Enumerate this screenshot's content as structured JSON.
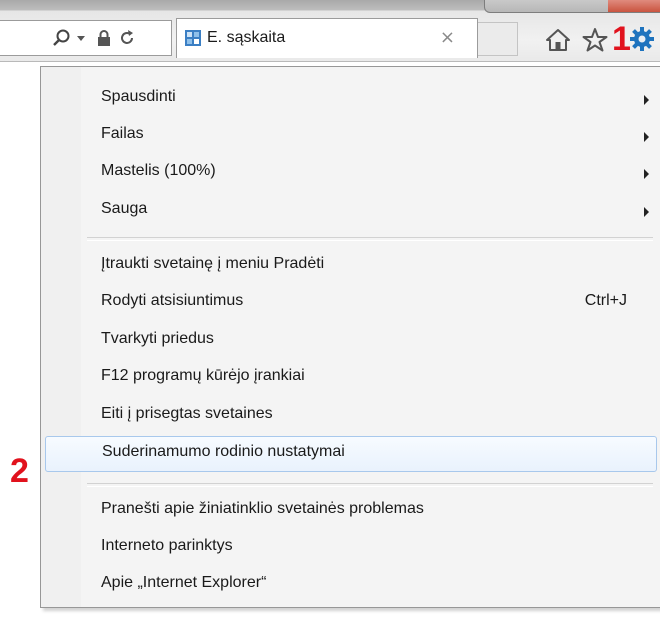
{
  "browser": {
    "tab": {
      "title": "E. sąskaita",
      "close_glyph": "×"
    },
    "address_icons": [
      {
        "name": "search-icon",
        "glyph": "⚲"
      },
      {
        "name": "dropdown-icon",
        "glyph": "▾"
      },
      {
        "name": "lock-icon",
        "glyph": "🔒"
      },
      {
        "name": "refresh-icon",
        "glyph": "↻"
      }
    ],
    "toolbar_icons": [
      "home-icon",
      "favorites-star-icon",
      "tools-gear-icon"
    ]
  },
  "annotations": {
    "marker_1": "1",
    "marker_2": "2",
    "color": "#e1121d"
  },
  "menu": {
    "groups": [
      {
        "items": [
          {
            "label": "Spausdinti",
            "submenu": true
          },
          {
            "label": "Failas",
            "submenu": true
          },
          {
            "label": "Mastelis (100%)",
            "submenu": true
          },
          {
            "label": "Sauga",
            "submenu": true
          }
        ]
      },
      {
        "items": [
          {
            "label": "Įtraukti svetainę į meniu Pradėti"
          },
          {
            "label": "Rodyti atsisiuntimus",
            "shortcut": "Ctrl+J"
          },
          {
            "label": "Tvarkyti priedus"
          },
          {
            "label": "F12 programų kūrėjo įrankiai"
          },
          {
            "label": "Eiti į prisegtas svetaines"
          },
          {
            "label": "Suderinamumo rodinio nustatymai",
            "highlighted": true
          }
        ]
      },
      {
        "items": [
          {
            "label": "Pranešti apie žiniatinklio svetainės problemas"
          },
          {
            "label": "Interneto parinktys"
          },
          {
            "label": "Apie „Internet Explorer“"
          }
        ]
      }
    ]
  },
  "colors": {
    "highlight_border": "#a8c8ec",
    "gear_icon": "#1e73be",
    "menu_background": "#f4f4f4"
  }
}
